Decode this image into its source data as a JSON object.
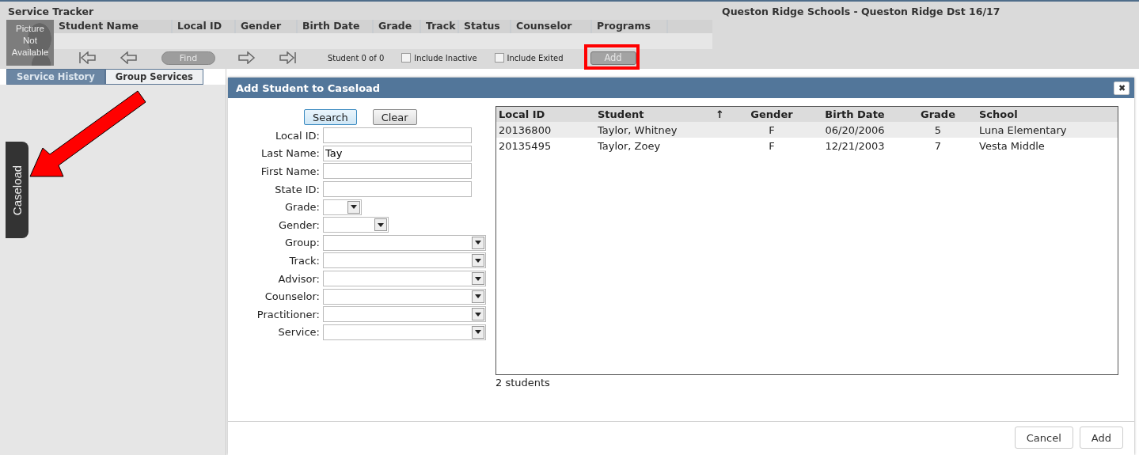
{
  "header": {
    "title": "Service Tracker",
    "district": "Queston Ridge Schools - Queston Ridge Dst 16/17",
    "photo_text": "Picture Not Available",
    "columns": [
      "Student Name",
      "Local ID",
      "Gender",
      "Birth Date",
      "Grade",
      "Track",
      "Status",
      "Counselor",
      "Programs"
    ],
    "find_button": {
      "label": "Find",
      "disabled": true
    },
    "record_count": "Student 0 of 0",
    "checkboxes": [
      {
        "label": "Include Inactive",
        "checked": false
      },
      {
        "label": "Include Exited",
        "checked": false
      }
    ],
    "add_button": {
      "label": "Add",
      "disabled": true,
      "highlighted": true
    }
  },
  "tabs": [
    {
      "label": "Service History",
      "selected": true
    },
    {
      "label": "Group Services",
      "selected": false
    }
  ],
  "side_tab": "Caseload",
  "annotation_arrow": true,
  "dialog": {
    "title": "Add Student to Caseload",
    "close": "✖",
    "search_button": "Search",
    "clear_button": "Clear",
    "fields": [
      {
        "label": "Local ID:",
        "kind": "text"
      },
      {
        "label": "Last Name:",
        "kind": "text",
        "value": "Tay"
      },
      {
        "label": "First Name:",
        "kind": "text"
      },
      {
        "label": "State ID:",
        "kind": "text"
      },
      {
        "label": "Grade:",
        "kind": "select"
      },
      {
        "label": "Gender:",
        "kind": "select"
      },
      {
        "label": "Group:",
        "kind": "select"
      },
      {
        "label": "Track:",
        "kind": "select"
      },
      {
        "label": "Advisor:",
        "kind": "select"
      },
      {
        "label": "Counselor:",
        "kind": "select"
      },
      {
        "label": "Practitioner:",
        "kind": "select"
      },
      {
        "label": "Service:",
        "kind": "select"
      }
    ],
    "table": {
      "columns": [
        "Local ID",
        "Student",
        "Gender",
        "Birth Date",
        "Grade",
        "School"
      ],
      "sort_mark": "↑",
      "rows": [
        {
          "cells": [
            "20136800",
            "Taylor, Whitney",
            "F",
            "06/20/2006",
            "5",
            "Luna Elementary"
          ],
          "selected": true
        },
        {
          "cells": [
            "20135495",
            "Taylor, Zoey",
            "F",
            "12/21/2003",
            "7",
            "Vesta Middle"
          ],
          "selected": false
        }
      ]
    },
    "count": "2 students",
    "buttons": [
      "Cancel",
      "Add"
    ]
  }
}
